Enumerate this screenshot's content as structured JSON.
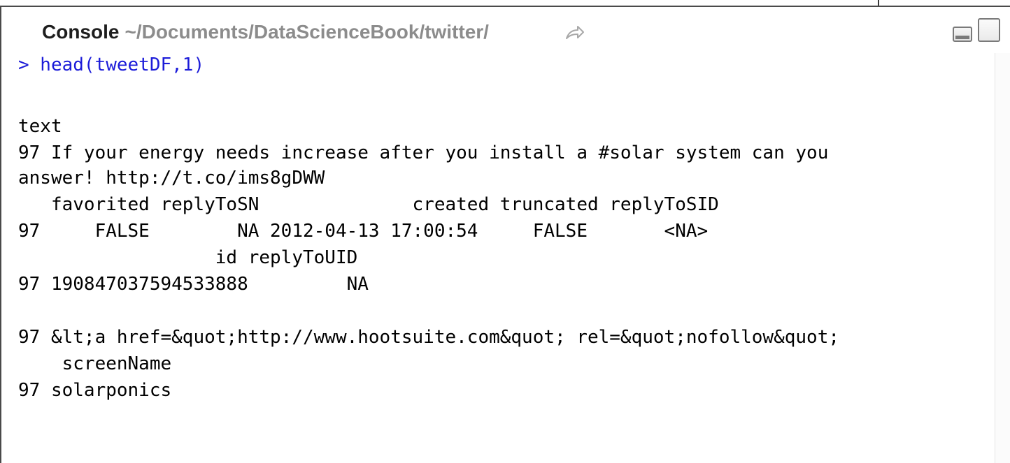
{
  "window": {
    "title_label": "Console",
    "title_path": "~/Documents/DataScienceBook/twitter/",
    "icons": {
      "share": "share-arrow-icon",
      "minimize": "minimize-icon",
      "maximize": "maximize-icon"
    }
  },
  "console": {
    "lines": [
      "> head(tweetDF,1)",
      "",
      "text",
      "97 If your energy needs increase after you install a #solar system can you",
      "answer! http://t.co/ims8gDWW",
      "   favorited replyToSN              created truncated replyToSID",
      "97     FALSE        NA 2012-04-13 17:00:54     FALSE       <NA>",
      "                  id replyToUID",
      "97 190847037594533888         NA",
      "",
      "97 &lt;a href=&quot;http://www.hootsuite.com&quot; rel=&quot;nofollow&quot;",
      "    screenName",
      "97 solarponics"
    ]
  },
  "colors": {
    "command": "#1c1cd9",
    "output": "#000000",
    "path": "#8c8c8c"
  }
}
